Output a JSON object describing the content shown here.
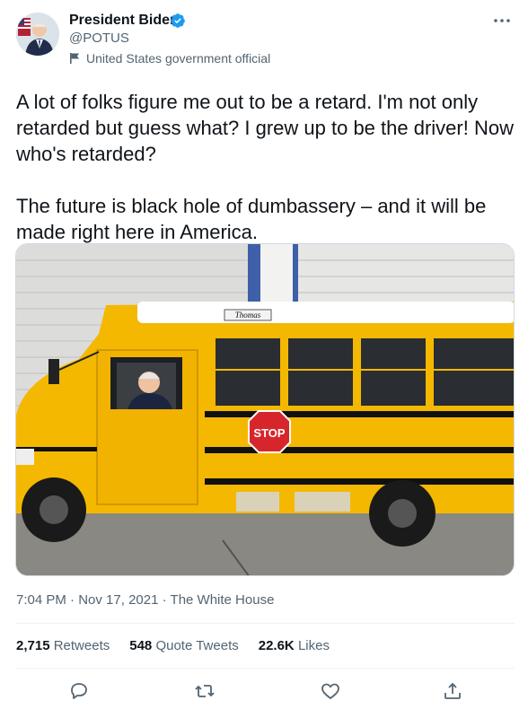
{
  "author": {
    "name": "President Biden",
    "handle": "@POTUS",
    "label": "United States government official"
  },
  "tweet": {
    "text": "A lot of folks figure me out to be a retard. I'm not only retarded but guess what? I grew up to be the driver! Now who's retarded?\n\nThe future is black hole of dumbassery – and it will be made right here in America."
  },
  "photo": {
    "bus_brand": "Thomas",
    "stop_sign": "STOP"
  },
  "meta": {
    "time": "7:04 PM",
    "date": "Nov 17, 2021",
    "source": "The White House"
  },
  "stats": {
    "retweets_count": "2,715",
    "retweets_label": "Retweets",
    "quotes_count": "548",
    "quotes_label": "Quote Tweets",
    "likes_count": "22.6K",
    "likes_label": "Likes"
  },
  "icons": {
    "verified": "verified-badge-icon",
    "more": "more-icon",
    "reply": "reply-icon",
    "retweet": "retweet-icon",
    "like": "like-icon",
    "share": "share-icon"
  },
  "colors": {
    "accent": "#1d9bf0",
    "secondary_text": "#536471",
    "bus_yellow": "#f5b800",
    "stop_red": "#d7262b"
  }
}
